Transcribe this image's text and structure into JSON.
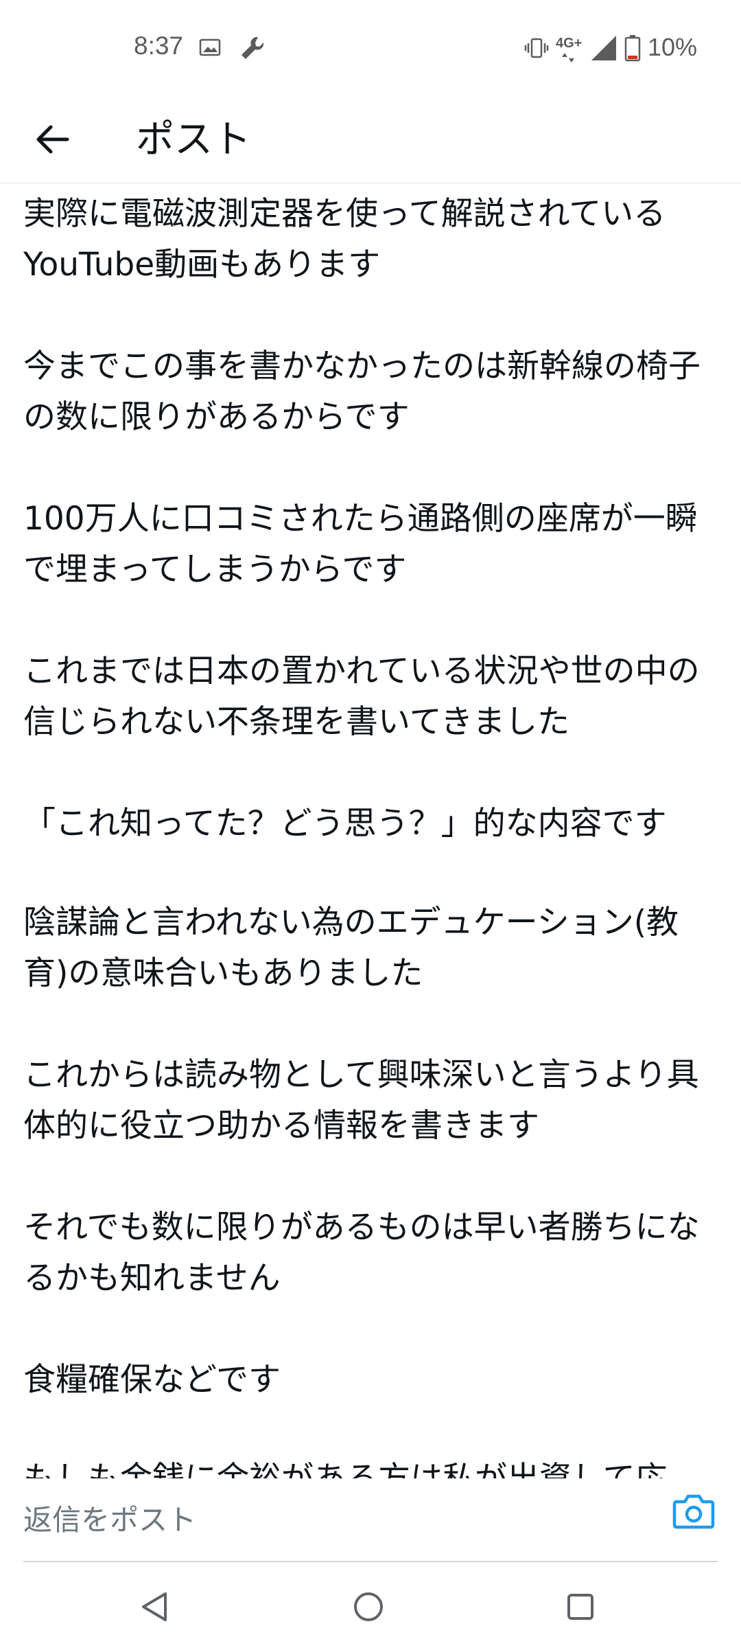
{
  "status_bar": {
    "time": "8:37",
    "network": "4G+",
    "battery": "10%",
    "icons": [
      "gallery-icon",
      "wrench-icon",
      "vibrate-icon",
      "signal-icon",
      "battery-low-icon"
    ]
  },
  "header": {
    "title": "ポスト",
    "back_icon": "arrow-left-icon"
  },
  "post": {
    "paragraphs": [
      "実際に電磁波測定器を使って解説されているYouTube動画もあります",
      "今までこの事を書かなかったのは新幹線の椅子の数に限りがあるからです",
      "100万人に口コミされたら通路側の座席が一瞬で埋まってしまうからです",
      "これまでは日本の置かれている状況や世の中の信じられない不条理を書いてきました",
      "「これ知ってた？どう思う？」的な内容です",
      "陰謀論と言われない為のエデュケーション(教育)の意味合いもありました",
      "これからは読み物として興味深いと言うより具体的に役立つ助かる情報を書きます",
      "それでも数に限りがあるものは早い者勝ちになるかも知れません",
      "食糧確保などです",
      "もしも金銭に余裕がある方は私が出資して応"
    ]
  },
  "reply": {
    "placeholder": "返信をポスト",
    "camera_icon": "camera-icon"
  },
  "nav": {
    "icons": [
      "back-triangle-icon",
      "home-circle-icon",
      "recents-square-icon"
    ]
  },
  "colors": {
    "accent": "#1d9bf0",
    "text": "#0f1419",
    "muted": "#536471"
  }
}
